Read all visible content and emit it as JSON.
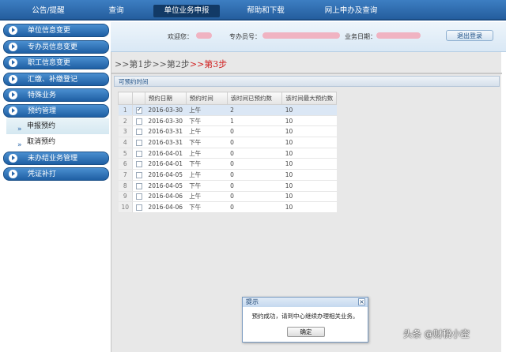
{
  "topnav": {
    "items": [
      "公告/提醒",
      "查询",
      "单位业务申报",
      "帮助和下载",
      "网上申办及查询"
    ],
    "active_index": 2
  },
  "sidebar": {
    "items": [
      "单位信息变更",
      "专办员信息变更",
      "职工信息变更",
      "汇缴、补缴登记",
      "特殊业务",
      "预约管理"
    ],
    "subitems": [
      "申报预约",
      "取消预约"
    ],
    "items_after": [
      "未办结业务管理",
      "凭证补打"
    ]
  },
  "header": {
    "contact_label": "欢迎您：",
    "agent_label": "专办员号：",
    "date_label": "业务日期：",
    "logout_label": "退出登录"
  },
  "steps": {
    "step1": ">>第1步",
    "step2": ">>第2步",
    "step3": ">>第3步"
  },
  "panel": {
    "title": "可预约时间"
  },
  "grid": {
    "columns": [
      "",
      "",
      "预约日期",
      "预约时间",
      "该时间已预约数",
      "该时间最大预约数"
    ],
    "rows": [
      {
        "n": "1",
        "checked": true,
        "date": "2016-03-30",
        "time": "上午",
        "booked": "2",
        "max": "10"
      },
      {
        "n": "2",
        "checked": false,
        "date": "2016-03-30",
        "time": "下午",
        "booked": "1",
        "max": "10"
      },
      {
        "n": "3",
        "checked": false,
        "date": "2016-03-31",
        "time": "上午",
        "booked": "0",
        "max": "10"
      },
      {
        "n": "4",
        "checked": false,
        "date": "2016-03-31",
        "time": "下午",
        "booked": "0",
        "max": "10"
      },
      {
        "n": "5",
        "checked": false,
        "date": "2016-04-01",
        "time": "上午",
        "booked": "0",
        "max": "10"
      },
      {
        "n": "6",
        "checked": false,
        "date": "2016-04-01",
        "time": "下午",
        "booked": "0",
        "max": "10"
      },
      {
        "n": "7",
        "checked": false,
        "date": "2016-04-05",
        "time": "上午",
        "booked": "0",
        "max": "10"
      },
      {
        "n": "8",
        "checked": false,
        "date": "2016-04-05",
        "time": "下午",
        "booked": "0",
        "max": "10"
      },
      {
        "n": "9",
        "checked": false,
        "date": "2016-04-06",
        "time": "上午",
        "booked": "0",
        "max": "10"
      },
      {
        "n": "10",
        "checked": false,
        "date": "2016-04-06",
        "time": "下午",
        "booked": "0",
        "max": "10"
      }
    ]
  },
  "dialog": {
    "title": "提示",
    "message": "预约成功，请到中心继续办理相关业务。",
    "ok_label": "确定"
  },
  "watermark": "头条 @财税小空",
  "colors": {
    "nav_blue": "#245e9e",
    "step_red": "#d02020"
  }
}
